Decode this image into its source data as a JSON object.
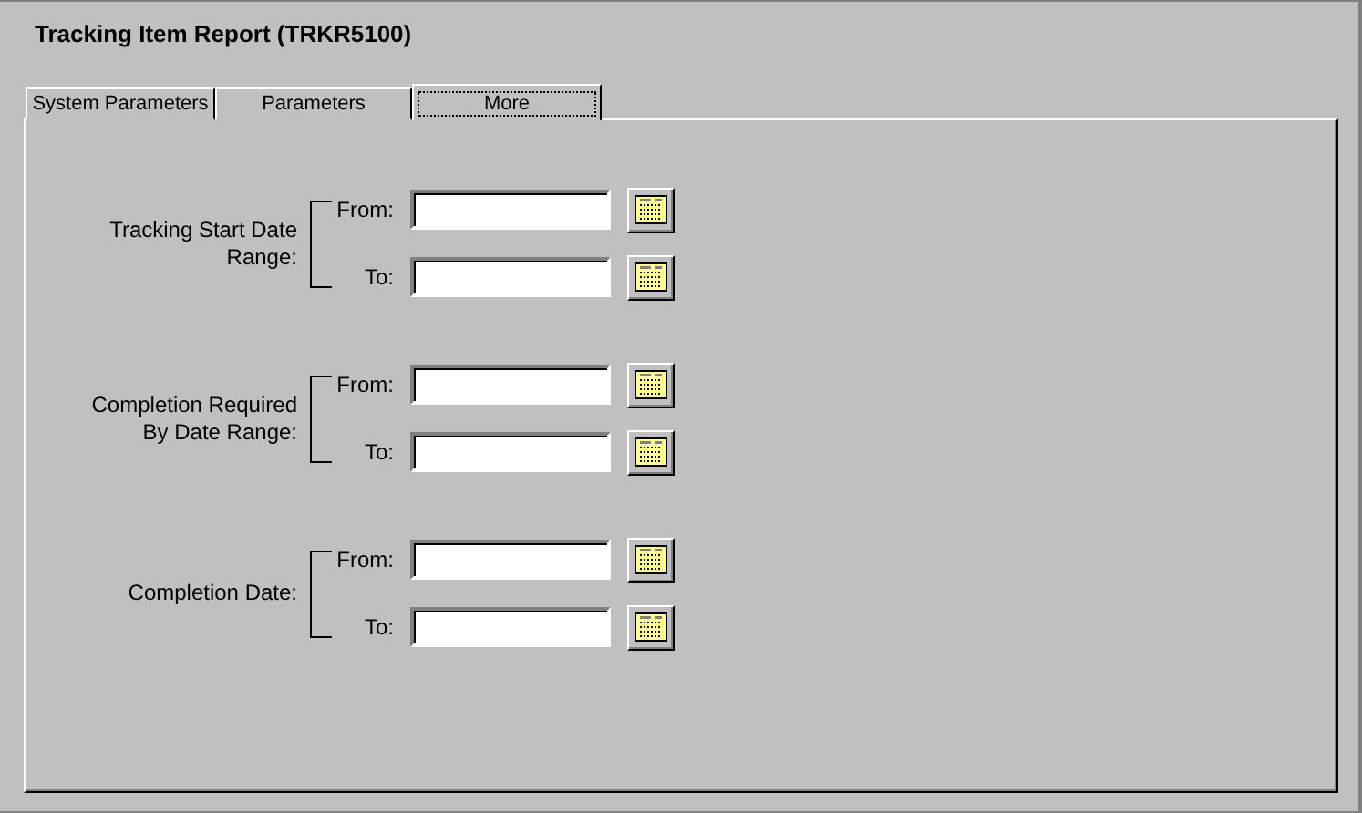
{
  "window": {
    "title": "Tracking Item Report (TRKR5100)"
  },
  "tabs": [
    {
      "label": "System Parameters",
      "selected": false
    },
    {
      "label": "Parameters",
      "selected": false
    },
    {
      "label": "More",
      "selected": true
    }
  ],
  "date_ranges": [
    {
      "label": "Tracking Start Date Range:",
      "from_label": "From:",
      "to_label": "To:"
    },
    {
      "label": "Completion Required By Date Range:",
      "from_label": "From:",
      "to_label": "To:"
    },
    {
      "label": "Completion Date:",
      "from_label": "From:",
      "to_label": "To:"
    }
  ]
}
